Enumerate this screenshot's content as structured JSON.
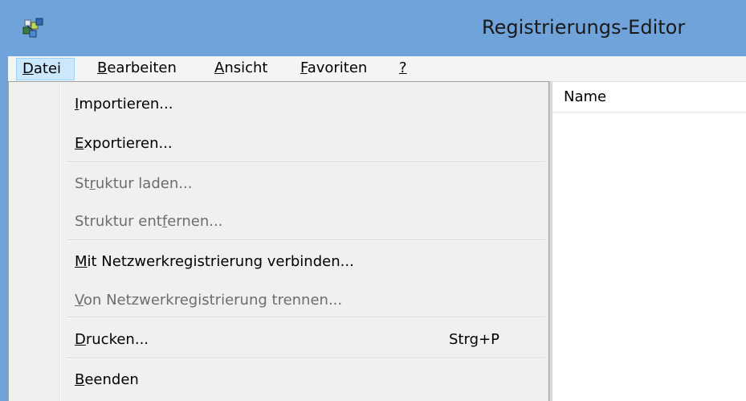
{
  "window": {
    "title": "Registrierungs-Editor"
  },
  "menubar": {
    "items": [
      {
        "pre": "",
        "key": "D",
        "post": "atei"
      },
      {
        "pre": "",
        "key": "B",
        "post": "earbeiten"
      },
      {
        "pre": "",
        "key": "A",
        "post": "nsicht"
      },
      {
        "pre": "",
        "key": "F",
        "post": "avoriten"
      },
      {
        "pre": "",
        "key": "?",
        "post": ""
      }
    ]
  },
  "list": {
    "column_name": "Name"
  },
  "file_menu": {
    "import": {
      "pre": "",
      "key": "I",
      "post": "mportieren..."
    },
    "export": {
      "pre": "",
      "key": "E",
      "post": "xportieren..."
    },
    "load_hive": {
      "pre": "St",
      "key": "r",
      "post": "uktur laden..."
    },
    "unload_hive": {
      "pre": "Struktur ent",
      "key": "f",
      "post": "ernen..."
    },
    "connect": {
      "pre": "",
      "key": "M",
      "post": "it Netzwerkregistrierung verbinden..."
    },
    "disconnect": {
      "pre": "",
      "key": "V",
      "post": "on Netzwerkregistrierung trennen..."
    },
    "print": {
      "pre": "",
      "key": "D",
      "post": "rucken...",
      "shortcut": "Strg+P"
    },
    "exit": {
      "pre": "",
      "key": "B",
      "post": "eenden"
    }
  },
  "icons": {
    "app": "registry-editor-icon"
  },
  "colors": {
    "titlebar": "#6fa3d9",
    "menu_active": "#cce8ff",
    "menu_bg": "#f0f0f0",
    "disabled_text": "#6d6d6d"
  }
}
